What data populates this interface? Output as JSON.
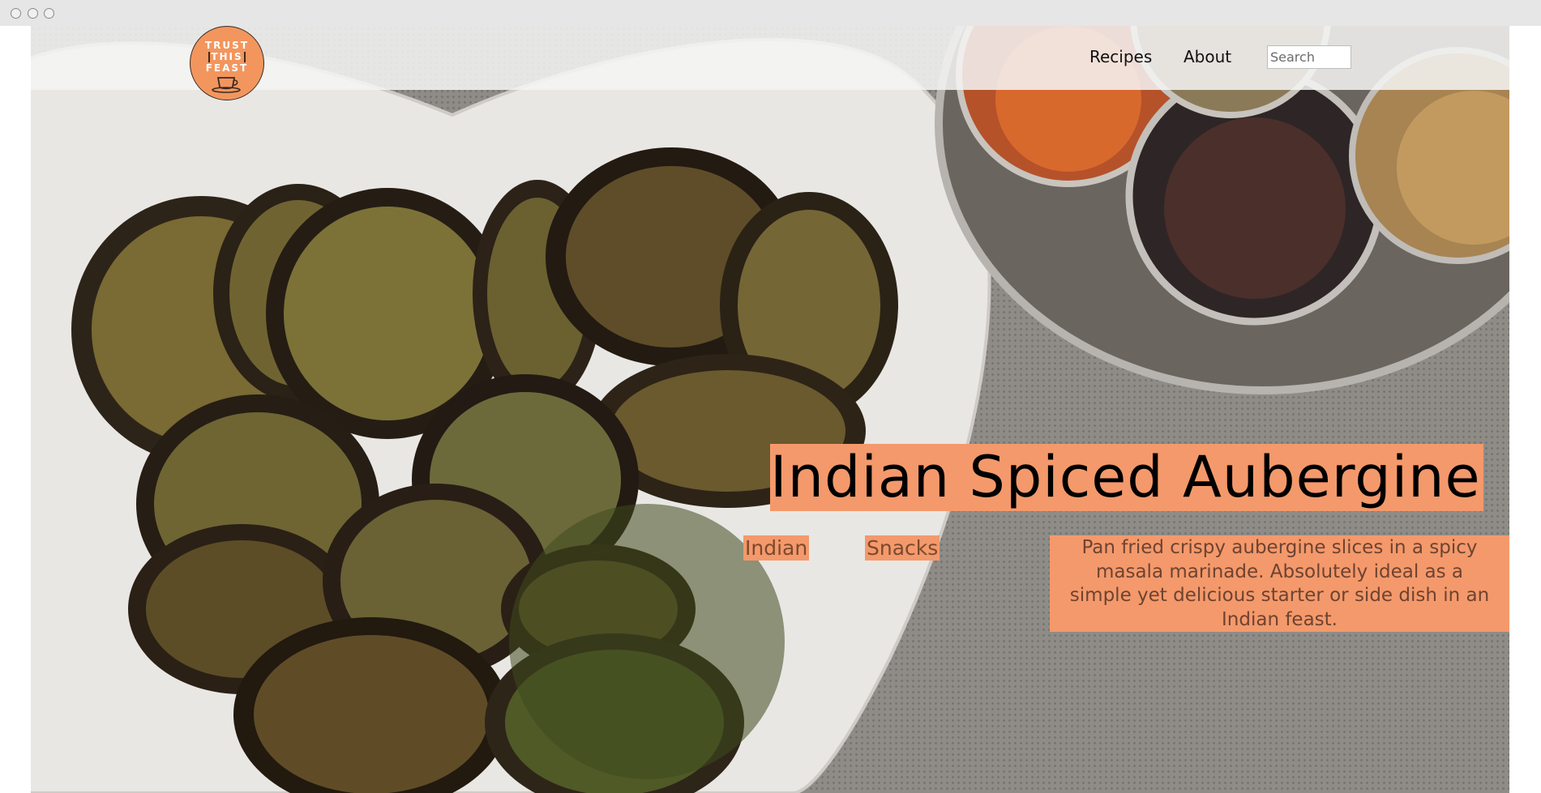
{
  "brand": {
    "logo_line1": "TRUST",
    "logo_line2": "THIS",
    "logo_line3": "FEAST"
  },
  "nav": {
    "recipes": "Recipes",
    "about": "About",
    "search_placeholder": "Search"
  },
  "hero": {
    "title": "Indian Spiced Aubergine",
    "tags": [
      "Indian",
      "Snacks"
    ],
    "description": "Pan fried crispy aubergine slices in a spicy masala marinade. Absolutely ideal as a simple yet delicious starter or side dish in an Indian feast."
  },
  "colors": {
    "accent": "#f4996b",
    "logo_bg": "#f2965e",
    "navbar_bg": "#f5f5f5"
  },
  "icons": {
    "window_controls": [
      "close-dot",
      "minimize-dot",
      "maximize-dot"
    ],
    "logo_icon": "teacup-icon"
  }
}
